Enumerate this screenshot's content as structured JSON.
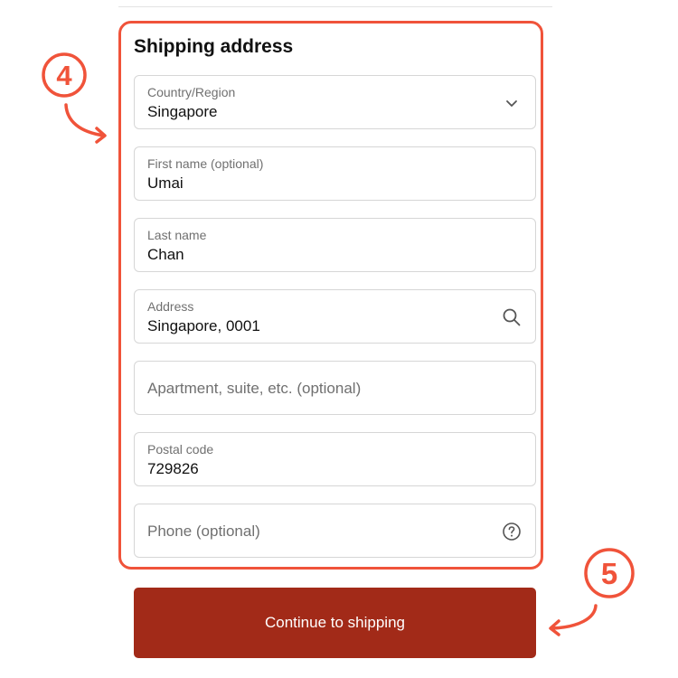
{
  "form": {
    "title": "Shipping address",
    "country": {
      "label": "Country/Region",
      "value": "Singapore"
    },
    "first_name": {
      "label": "First name (optional)",
      "value": "Umai"
    },
    "last_name": {
      "label": "Last name",
      "value": "Chan"
    },
    "address": {
      "label": "Address",
      "value": "Singapore, 0001"
    },
    "apartment": {
      "placeholder": "Apartment, suite, etc. (optional)"
    },
    "postal_code": {
      "label": "Postal code",
      "value": "729826"
    },
    "phone": {
      "placeholder": "Phone (optional)"
    }
  },
  "continue_button": {
    "label": "Continue to shipping"
  },
  "annotations": {
    "step_4": "4",
    "step_5": "5"
  },
  "colors": {
    "highlight": "#f0533a",
    "button": "#a22a18"
  },
  "icons": {
    "country": "chevron-down-icon",
    "address": "search-icon",
    "phone": "help-circle-icon",
    "step_4_arrow": "arrow-curved-right-icon",
    "step_5_arrow": "arrow-curved-left-icon"
  }
}
